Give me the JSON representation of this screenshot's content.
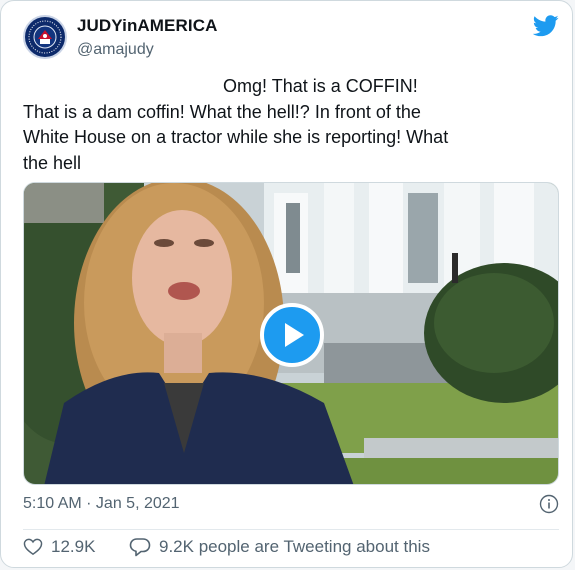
{
  "author": {
    "display_name": "JUDYinAMERICA",
    "handle": "@amajudy"
  },
  "tweet": {
    "text": "                                        Omg! That is a COFFIN!\nThat is a dam coffin! What the hell!? In front of the\nWhite House on a tractor while she is reporting! What\nthe hell",
    "timestamp": "5:10 AM · Jan 5, 2021"
  },
  "engagement": {
    "likes": "12.9K",
    "conversation": "9.2K people are Tweeting about this"
  },
  "icons": {
    "brand": "twitter-bird-icon",
    "play": "play-icon",
    "info": "info-icon",
    "like": "heart-icon",
    "reply": "reply-icon"
  },
  "colors": {
    "accent": "#1d9bf0",
    "text": "#0f1419",
    "muted": "#536471",
    "border": "#cfd9de"
  }
}
